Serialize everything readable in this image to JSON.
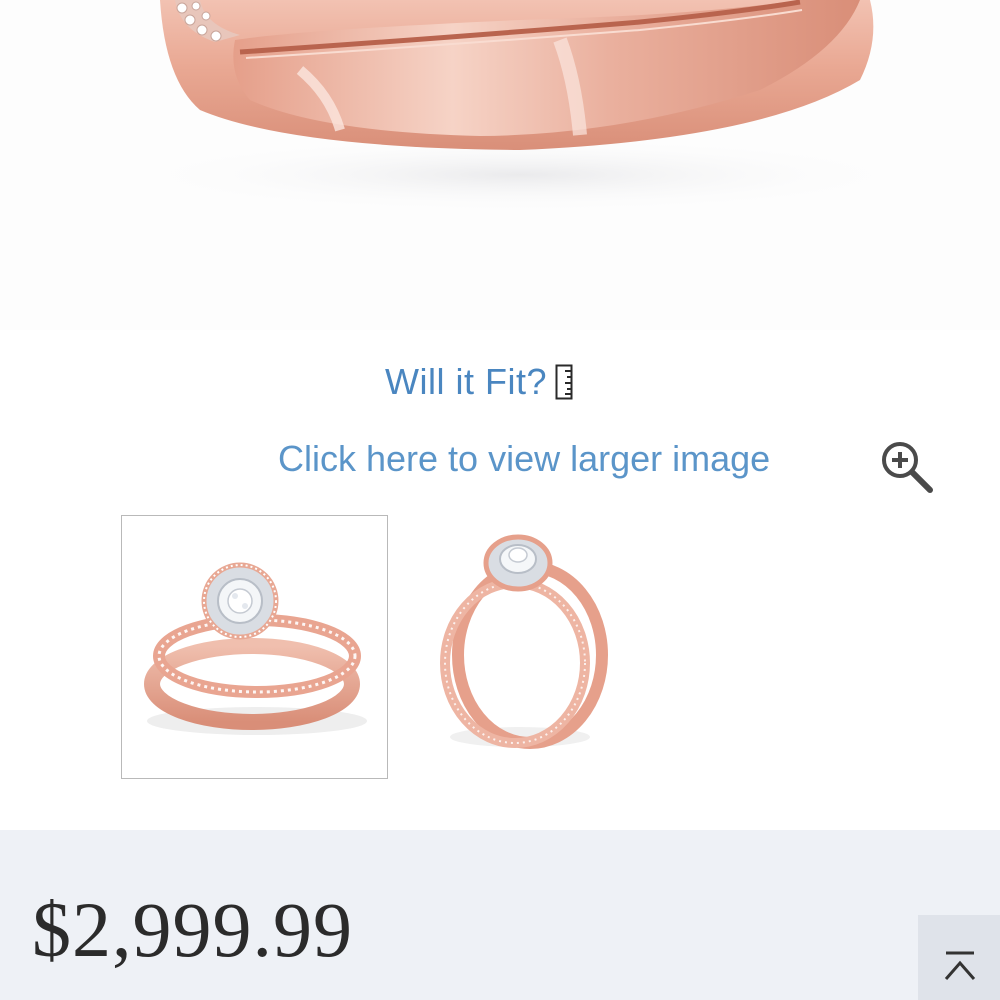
{
  "hero": {
    "alt_icon": "rose-gold-ring-bands-closeup"
  },
  "fit": {
    "label": "Will it Fit?",
    "icon": "ruler-icon"
  },
  "larger_image": {
    "label": "Click here to view larger image",
    "icon": "zoom-in-icon"
  },
  "thumbnails": [
    {
      "view": "angled-ring-set",
      "selected": true
    },
    {
      "view": "side-ring-set",
      "selected": false
    }
  ],
  "price": {
    "value": "$2,999.99"
  },
  "scroll_top": {
    "icon": "chevron-up-icon"
  },
  "colors": {
    "link": "#4a86c0",
    "rose_gold": "#e7a38f",
    "price_bar": "#eef1f6"
  }
}
